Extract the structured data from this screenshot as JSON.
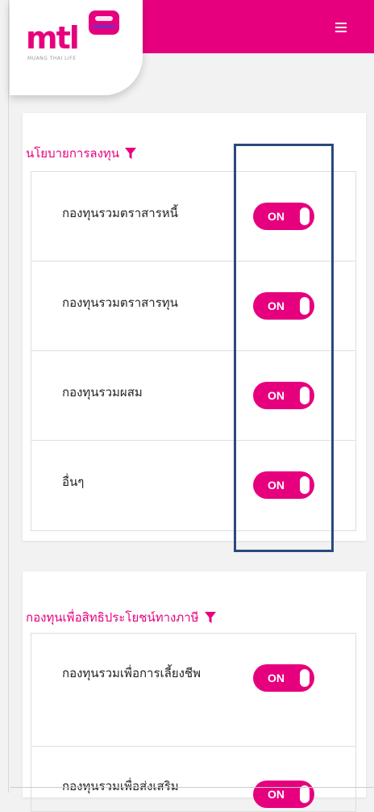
{
  "header": {
    "logo_text": "mtl",
    "logo_tagline": "MUANG THAI LIFE",
    "logo_badge_icon": "mtl-badge-logo",
    "menu_icon": "hamburger-menu-icon",
    "brand_color": "#e6007e"
  },
  "sections": [
    {
      "title": "นโยบายการลงทุน",
      "title_icon": "funnel-filter-icon",
      "items": [
        {
          "label": "กองทุนรวมตราสารหนี้",
          "toggle": "ON"
        },
        {
          "label": "กองทุนรวมตราสารทุน",
          "toggle": "ON"
        },
        {
          "label": "กองทุนรวมผสม",
          "toggle": "ON"
        },
        {
          "label": "อื่นๆ",
          "toggle": "ON"
        }
      ]
    },
    {
      "title": "กองทุนเพื่อสิทธิประโยชน์ทางภาษี",
      "title_icon": "funnel-filter-icon",
      "items": [
        {
          "label": "กองทุนรวมเพื่อการเลี้ยงชีพ",
          "toggle": "ON"
        },
        {
          "label": "กองทุนรวมเพื่อส่งเสริม",
          "toggle": "ON"
        }
      ]
    }
  ],
  "colors": {
    "accent": "#e6007e",
    "highlight_border": "#2a4a7d"
  }
}
